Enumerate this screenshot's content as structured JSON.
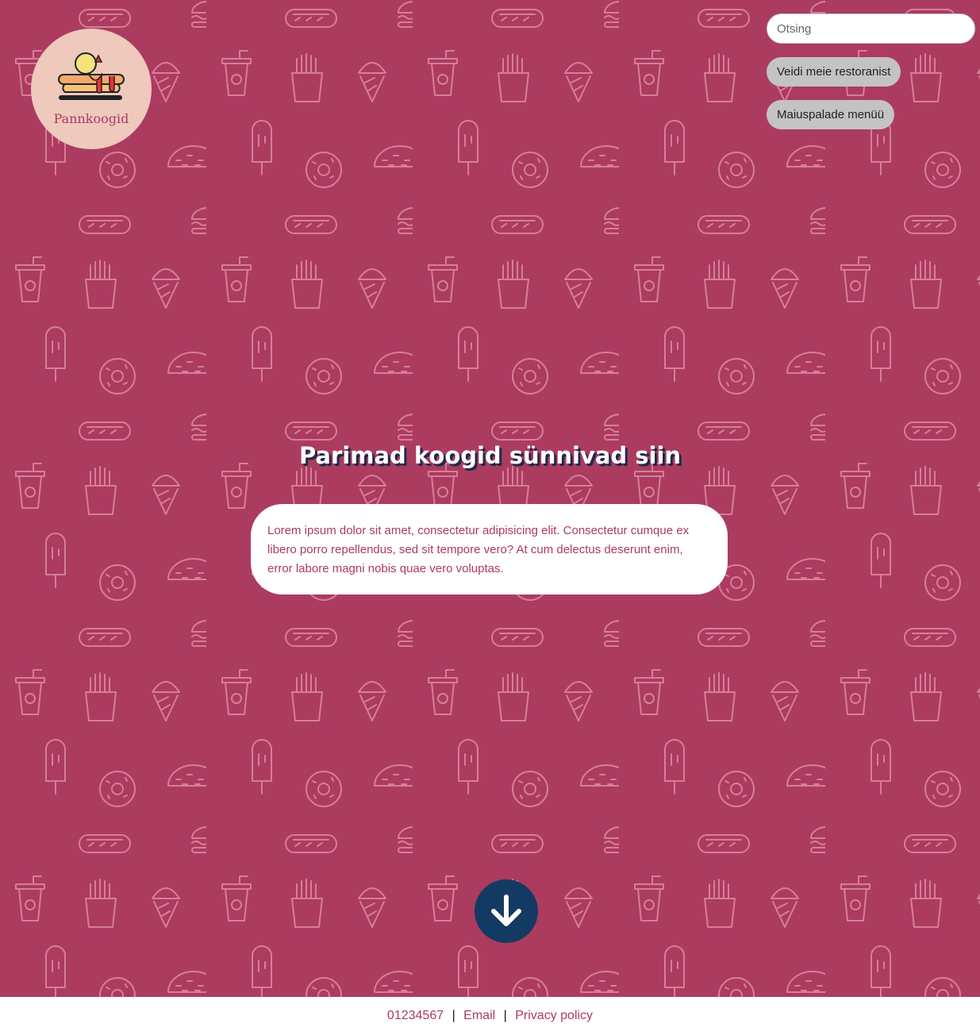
{
  "brand": {
    "name": "Pannkoogid",
    "icon": "pancake-stack-icon"
  },
  "search": {
    "placeholder": "Otsing"
  },
  "nav": {
    "items": [
      {
        "label": "Veidi meie restoranist"
      },
      {
        "label": "Maiuspalade menüü"
      }
    ]
  },
  "hero": {
    "title": "Parimad koogid sünnivad siin",
    "description": "Lorem ipsum dolor sit amet, consectetur adipisicing elit. Consectetur cumque ex libero porro repellendus, sed sit tempore vero? At cum delectus deserunt enim, error labore magni nobis quae vero voluptas.",
    "scroll_icon": "arrow-down-circle-icon",
    "background_pattern": "food-doodle-pattern"
  },
  "footer": {
    "phone": "01234567",
    "separator": "|",
    "email_label": "Email",
    "privacy_label": "Privacy policy"
  },
  "colors": {
    "primary": "#ac3b60",
    "pattern_stroke": "#d77e98",
    "logo_bg": "#eec9bc",
    "button_bg": "#c3c3c3",
    "accent_dark": "#133a63",
    "headline_shadow": "#1f2a4a",
    "white": "#ffffff"
  }
}
